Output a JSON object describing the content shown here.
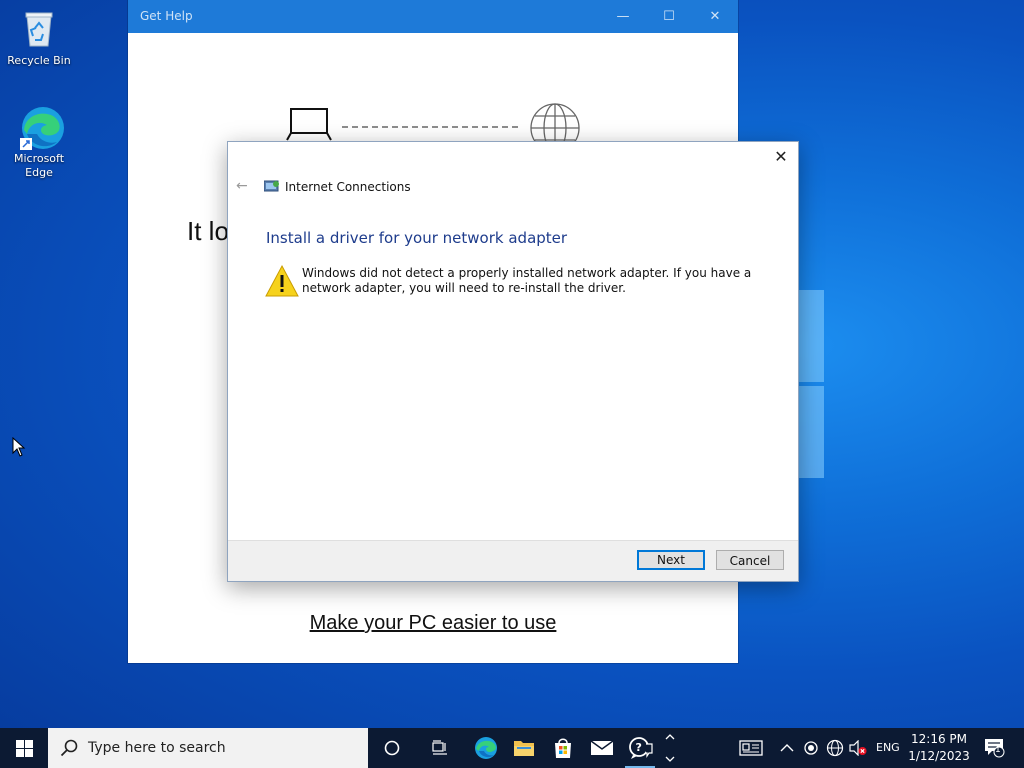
{
  "desktop": {
    "icons": [
      {
        "label": "Recycle Bin"
      },
      {
        "label": "Microsoft Edge"
      }
    ]
  },
  "get_help": {
    "title": "Get Help",
    "heading_partial": "It lo",
    "link": "Make your PC easier to use"
  },
  "dialog": {
    "title": "Internet Connections",
    "heading": "Install a driver for your network adapter",
    "message": "Windows did not detect a properly installed network adapter. If you have a network adapter, you will need to re-install the driver.",
    "next_label": "Next",
    "cancel_label": "Cancel"
  },
  "taskbar": {
    "search_placeholder": "Type here to search",
    "language": "ENG",
    "time": "12:16 PM",
    "date": "1/12/2023",
    "notification_count": "1"
  },
  "colors": {
    "accent": "#0078d7",
    "heading_blue": "#1e3c8c",
    "taskbar": "#0c1a33"
  }
}
